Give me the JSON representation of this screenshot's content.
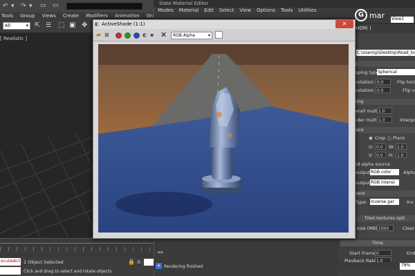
{
  "main_app": {
    "menu": [
      "Tools",
      "Group",
      "Views",
      "Create",
      "Modifiers",
      "Animation",
      "Graph"
    ],
    "selection_filter": "All",
    "viewport_label": "[ Realistic ]",
    "status": {
      "script_listener": "scuteAct",
      "selection_count": "1 Object Selected",
      "hint": "Click and drag to select and rotate objects",
      "coord_x_label": "X:"
    }
  },
  "slate": {
    "title": "Slate Material Editor",
    "menu": [
      "Modes",
      "Material",
      "Edit",
      "Select",
      "View",
      "Options",
      "Tools",
      "Utilities"
    ],
    "view_tab": "View1",
    "logo_letter": "G",
    "logo_text": "mar",
    "hdri_label": "yHDRI )",
    "file_path": "C:\\Users\\p\\Desktop\\Road_to_",
    "mapping_section": "g",
    "mapping_type_label": "pping type:",
    "mapping_type_value": "Spherical",
    "hrot_label": ". rotation:",
    "hrot_value": "0.0",
    "flip_h_label": "Flip horiz",
    "vrot_label": ". rotation:",
    "vrot_value": "0.0",
    "flip_v_label": "Flip ve",
    "processing_section": "sing",
    "overall_mult_label": "erall mult:",
    "overall_mult_value": "1.0",
    "render_mult_label": "nder mult:",
    "render_mult_value": "1.0",
    "interp_label": "Interpol",
    "place_section": "lace",
    "crop_label": "Crop",
    "place_label": "Place",
    "u_label": "U:",
    "u_value": "0.0",
    "v_label": "V:",
    "v_value": "0.0",
    "w_label": "W:",
    "w_value": "1.0",
    "h_label": "H:",
    "h_value": "1.0",
    "alpha_section": "nd alpha source",
    "rgb_output_label": "output:",
    "rgb_output_value": "RGB color",
    "alpha_label": "Alpha",
    "mono_output_label": "output:",
    "mono_output_value": "RGB intensi",
    "space_section": "pace",
    "space_type_label": "Type:",
    "space_type_value": "Inverse gar",
    "inv_label": "Inv",
    "tiled_label": "Tiled textures opti",
    "size_label": "size (MB):",
    "size_value": "1000",
    "clear_label": "Clear",
    "time_label": "Time",
    "start_frame_label": "Start Frame:",
    "start_frame_value": "0",
    "end_label": "End",
    "playback_label": "Playback Rate:",
    "playback_value": "1.0",
    "zoom": "78%",
    "status": "Rendering finished"
  },
  "activeshade": {
    "title": "ActiveShade (1:1)",
    "close_icon": "close-icon",
    "channel": "RGB Alpha",
    "colors": {
      "red": "#e02020",
      "green": "#20a020",
      "blue": "#2040d0"
    }
  }
}
